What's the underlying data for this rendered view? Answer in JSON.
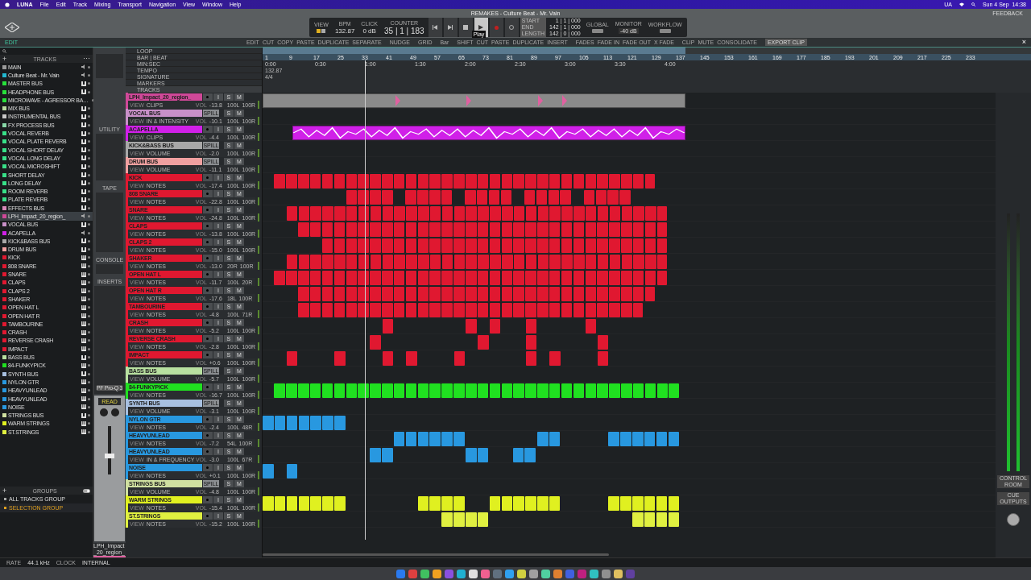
{
  "menu_bar": {
    "app": "LUNA",
    "items": [
      "File",
      "Edit",
      "Track",
      "Mixing",
      "Transport",
      "Navigation",
      "View",
      "Window",
      "Help"
    ],
    "status": "UA",
    "clock": "Sun 4 Sep  14:38"
  },
  "window": {
    "title": "REMAKES - Culture Beat - Mr. Vain",
    "feedback": "FEEDBACK"
  },
  "transport": {
    "sections": [
      {
        "label": "VIEW"
      },
      {
        "label": "BPM",
        "value": "132.87"
      },
      {
        "label": "CLICK",
        "value": "0 dB"
      },
      {
        "label": "COUNTER",
        "value": "35 | 1 | 183"
      }
    ],
    "tooltip": "Play",
    "times": [
      {
        "label": "START",
        "value": "1 | 1 | 000"
      },
      {
        "label": "END",
        "value": "142 | 1 | 000"
      },
      {
        "label": "LENGTH",
        "value": "142 | 0 | 000"
      }
    ],
    "right_sections": [
      {
        "label": "GLOBAL"
      },
      {
        "label": "MONITOR",
        "value": "-40 dB"
      },
      {
        "label": "WORKFLOW"
      }
    ]
  },
  "edit_toolbar": {
    "mode": "EDIT",
    "groups": [
      [
        "EDIT",
        "CUT",
        "COPY",
        "PASTE",
        "DUPLICATE",
        "SEPARATE"
      ],
      [
        "NUDGE"
      ],
      [
        "GRID"
      ],
      [
        "Bar"
      ],
      [
        "SHIFT",
        "CUT",
        "PASTE",
        "DUPLICATE",
        "INSERT"
      ],
      [
        "FADES",
        "FADE IN",
        "FADE OUT",
        "X FADE"
      ],
      [
        "CLIP",
        "MUTE",
        "CONSOLIDATE"
      ]
    ],
    "export": "EXPORT CLIP",
    "close": "×"
  },
  "sidebar": {
    "add": "+",
    "title": "TRACKS",
    "more": "⋯",
    "items": [
      {
        "name": "MAIN",
        "color": "#9a9a9a",
        "kind": "audio",
        "selected": false
      },
      {
        "name": "Culture Beat - Mr. Vain",
        "color": "#22b8d0",
        "kind": "audio",
        "selected": false
      },
      {
        "name": "MASTER BUS",
        "color": "#27e03a",
        "kind": "bus",
        "selected": false
      },
      {
        "name": "HEADPHONE BUS",
        "color": "#27e03a",
        "kind": "bus",
        "selected": false
      },
      {
        "name": "MICROWAVE - AGRESSOR BA…",
        "color": "#27e03a",
        "kind": "instrument",
        "selected": false
      },
      {
        "name": "MIX BUS",
        "color": "#b8d8a0",
        "kind": "bus",
        "selected": false
      },
      {
        "name": "INSTRUMENTAL BUS",
        "color": "#c8c8c8",
        "kind": "bus",
        "selected": false
      },
      {
        "name": "FX PROCESS BUS",
        "color": "#88d8a8",
        "kind": "bus",
        "selected": false
      },
      {
        "name": "VOCAL REVERB",
        "color": "#38e088",
        "kind": "bus",
        "selected": false
      },
      {
        "name": "VOCAL PLATE REVERB",
        "color": "#38e088",
        "kind": "bus",
        "selected": false
      },
      {
        "name": "VOCAL SHORT DELAY",
        "color": "#38e088",
        "kind": "bus",
        "selected": false
      },
      {
        "name": "VOCAL LONG DELAY",
        "color": "#38e088",
        "kind": "bus",
        "selected": false
      },
      {
        "name": "VOCAL MICROSHIFT",
        "color": "#38e088",
        "kind": "bus",
        "selected": false
      },
      {
        "name": "SHORT DELAY",
        "color": "#38e088",
        "kind": "bus",
        "selected": false
      },
      {
        "name": "LONG DELAY",
        "color": "#38e088",
        "kind": "bus",
        "selected": false
      },
      {
        "name": "ROOM REVERB",
        "color": "#38e088",
        "kind": "bus",
        "selected": false
      },
      {
        "name": "PLATE REVERB",
        "color": "#38e088",
        "kind": "bus",
        "selected": false
      },
      {
        "name": "EFFECTS BUS",
        "color": "#d888b8",
        "kind": "bus",
        "selected": false
      },
      {
        "name": "LPH_Impact_20_region_",
        "color": "#d04898",
        "kind": "audio",
        "selected": true
      },
      {
        "name": "VOCAL BUS",
        "color": "#c890c8",
        "kind": "bus",
        "selected": false
      },
      {
        "name": "ACAPELLA",
        "color": "#d020e8",
        "kind": "audio",
        "selected": false
      },
      {
        "name": "KICK&BASS BUS",
        "color": "#a8a8a8",
        "kind": "bus",
        "selected": false
      },
      {
        "name": "DRUM BUS",
        "color": "#f0a0a0",
        "kind": "bus",
        "selected": false
      },
      {
        "name": "KICK",
        "color": "#e01830",
        "kind": "instrument",
        "selected": false
      },
      {
        "name": "808 SNARE",
        "color": "#e01830",
        "kind": "instrument",
        "selected": false
      },
      {
        "name": "SNARE",
        "color": "#e01830",
        "kind": "instrument",
        "selected": false
      },
      {
        "name": "CLAPS",
        "color": "#e01830",
        "kind": "instrument",
        "selected": false
      },
      {
        "name": "CLAPS 2",
        "color": "#e01830",
        "kind": "instrument",
        "selected": false
      },
      {
        "name": "SHAKER",
        "color": "#e01830",
        "kind": "instrument",
        "selected": false
      },
      {
        "name": "OPEN HAT L",
        "color": "#e01830",
        "kind": "instrument",
        "selected": false
      },
      {
        "name": "OPEN HAT R",
        "color": "#e01830",
        "kind": "instrument",
        "selected": false
      },
      {
        "name": "TAMBOURINE",
        "color": "#e01830",
        "kind": "instrument",
        "selected": false
      },
      {
        "name": "CRASH",
        "color": "#e01830",
        "kind": "instrument",
        "selected": false
      },
      {
        "name": "REVERSE CRASH",
        "color": "#e01830",
        "kind": "instrument",
        "selected": false
      },
      {
        "name": "IMPACT",
        "color": "#e01830",
        "kind": "instrument",
        "selected": false
      },
      {
        "name": "BASS BUS",
        "color": "#b8e0a0",
        "kind": "bus",
        "selected": false
      },
      {
        "name": "84-FUNKYPICK",
        "color": "#20e020",
        "kind": "instrument",
        "selected": false
      },
      {
        "name": "SYNTH BUS",
        "color": "#a8c0e0",
        "kind": "bus",
        "selected": false
      },
      {
        "name": "NYLON GTR",
        "color": "#2898e0",
        "kind": "instrument",
        "selected": false
      },
      {
        "name": "HEAVYUNLEAD",
        "color": "#2898e0",
        "kind": "instrument",
        "selected": false
      },
      {
        "name": "HEAVYUNLEAD",
        "color": "#2898e0",
        "kind": "instrument",
        "selected": false
      },
      {
        "name": "NOISE",
        "color": "#2898e0",
        "kind": "instrument",
        "selected": false
      },
      {
        "name": "STRINGS BUS",
        "color": "#d0e0a0",
        "kind": "bus",
        "selected": false
      },
      {
        "name": "WARM STRINGS",
        "color": "#e0f020",
        "kind": "instrument",
        "selected": false
      },
      {
        "name": "ST.STRINGS",
        "color": "#e0f040",
        "kind": "instrument",
        "selected": false
      }
    ],
    "groups_add": "+",
    "groups_title": "GROUPS",
    "groups_on": true,
    "groups": [
      {
        "name": "ALL TRACKS GROUP",
        "selected": false
      },
      {
        "name": "SELECTION GROUP",
        "selected": true
      }
    ]
  },
  "channel_strip": {
    "labels": [
      "UTILITY",
      "TAPE",
      "CONSOLE",
      "INSERTS"
    ],
    "plugin": "PF Pro-Q 3",
    "automation": "READ",
    "track": "LPH_Impact_20_region_"
  },
  "ruler": {
    "rows": [
      "LOOP",
      "BAR | BEAT",
      "MIN:SEC",
      "TEMPO",
      "SIGNATURE",
      "MARKERS"
    ],
    "tracks_label": "TRACKS",
    "tempo": "132.87",
    "signature": "4/4",
    "bars": [
      "1",
      "9",
      "17",
      "25",
      "33",
      "41",
      "49",
      "57",
      "65",
      "73",
      "81",
      "89",
      "97",
      "105",
      "113",
      "121",
      "129",
      "137",
      "145",
      "153",
      "161",
      "169",
      "177",
      "185",
      "193",
      "201",
      "209",
      "217",
      "225",
      "233"
    ],
    "times": [
      "0:00",
      "0:30",
      "1:00",
      "1:30",
      "2:00",
      "2:30",
      "3:00",
      "3:30",
      "4:00"
    ]
  },
  "tracks": [
    {
      "name": "LPH_Impact_20_region_",
      "color": "#d04898",
      "kind": "track",
      "buttons": [
        "I",
        "S",
        "M"
      ],
      "view_label": "VIEW",
      "mode": "CLIPS",
      "vol_label": "VOL",
      "vol": "-13.8",
      "pan_l": "100L",
      "pan_r": "100R"
    },
    {
      "name": "VOCAL BUS",
      "color": "#c890c8",
      "kind": "bus",
      "buttons": [
        "SPILL",
        "S",
        "M"
      ],
      "view_label": "VIEW",
      "mode": "IN & INTENSITY",
      "vol_label": "VOL",
      "vol": "-10.1",
      "pan_l": "100L",
      "pan_r": "100R"
    },
    {
      "name": "ACAPELLA",
      "color": "#d020e8",
      "kind": "track",
      "buttons": [
        "I",
        "S",
        "M"
      ],
      "view_label": "VIEW",
      "mode": "CLIPS",
      "vol_label": "VOL",
      "vol": "-4.4",
      "pan_l": "100L",
      "pan_r": "100R"
    },
    {
      "name": "KICK&BASS BUS",
      "color": "#a8a8a8",
      "kind": "bus",
      "buttons": [
        "SPILL",
        "S",
        "M"
      ],
      "view_label": "VIEW",
      "mode": "VOLUME",
      "vol_label": "VOL",
      "vol": "-2.0",
      "pan_l": "100L",
      "pan_r": "100R"
    },
    {
      "name": "DRUM BUS",
      "color": "#f0a0a0",
      "kind": "bus",
      "buttons": [
        "SPILL",
        "S",
        "M"
      ],
      "view_label": "VIEW",
      "mode": "VOLUME",
      "vol_label": "VOL",
      "vol": "-11.1",
      "pan_l": "100L",
      "pan_r": "100R"
    },
    {
      "name": "KICK",
      "color": "#e01830",
      "kind": "track",
      "buttons": [
        "I",
        "S",
        "M"
      ],
      "view_label": "VIEW",
      "mode": "NOTES",
      "vol_label": "VOL",
      "vol": "-17.4",
      "pan_l": "100L",
      "pan_r": "100R"
    },
    {
      "name": "808 SNARE",
      "color": "#e01830",
      "kind": "track",
      "buttons": [
        "I",
        "S",
        "M"
      ],
      "view_label": "VIEW",
      "mode": "NOTES",
      "vol_label": "VOL",
      "vol": "-22.8",
      "pan_l": "100L",
      "pan_r": "100R"
    },
    {
      "name": "SNARE",
      "color": "#e01830",
      "kind": "track",
      "buttons": [
        "I",
        "S",
        "M"
      ],
      "view_label": "VIEW",
      "mode": "NOTES",
      "vol_label": "VOL",
      "vol": "-24.8",
      "pan_l": "100L",
      "pan_r": "100R"
    },
    {
      "name": "CLAPS",
      "color": "#e01830",
      "kind": "track",
      "buttons": [
        "I",
        "S",
        "M"
      ],
      "view_label": "VIEW",
      "mode": "NOTES",
      "vol_label": "VOL",
      "vol": "-13.8",
      "pan_l": "100L",
      "pan_r": "100R"
    },
    {
      "name": "CLAPS 2",
      "color": "#e01830",
      "kind": "track",
      "buttons": [
        "I",
        "S",
        "M"
      ],
      "view_label": "VIEW",
      "mode": "NOTES",
      "vol_label": "VOL",
      "vol": "-15.0",
      "pan_l": "100L",
      "pan_r": "100R"
    },
    {
      "name": "SHAKER",
      "color": "#e01830",
      "kind": "track",
      "buttons": [
        "I",
        "S",
        "M"
      ],
      "view_label": "VIEW",
      "mode": "NOTES",
      "vol_label": "VOL",
      "vol": "-13.0",
      "pan_l": "20R",
      "pan_r": "100R"
    },
    {
      "name": "OPEN HAT L",
      "color": "#e01830",
      "kind": "track",
      "buttons": [
        "I",
        "S",
        "M"
      ],
      "view_label": "VIEW",
      "mode": "NOTES",
      "vol_label": "VOL",
      "vol": "-11.7",
      "pan_l": "100L",
      "pan_r": "20R"
    },
    {
      "name": "OPEN HAT R",
      "color": "#e01830",
      "kind": "track",
      "buttons": [
        "I",
        "S",
        "M"
      ],
      "view_label": "VIEW",
      "mode": "NOTES",
      "vol_label": "VOL",
      "vol": "-17.6",
      "pan_l": "18L",
      "pan_r": "100R"
    },
    {
      "name": "TAMBOURINE",
      "color": "#e01830",
      "kind": "track",
      "buttons": [
        "I",
        "S",
        "M"
      ],
      "view_label": "VIEW",
      "mode": "NOTES",
      "vol_label": "VOL",
      "vol": "-4.8",
      "pan_l": "100L",
      "pan_r": "71R"
    },
    {
      "name": "CRASH",
      "color": "#e01830",
      "kind": "track",
      "buttons": [
        "I",
        "S",
        "M"
      ],
      "view_label": "VIEW",
      "mode": "NOTES",
      "vol_label": "VOL",
      "vol": "-5.2",
      "pan_l": "100L",
      "pan_r": "100R"
    },
    {
      "name": "REVERSE CRASH",
      "color": "#e01830",
      "kind": "track",
      "buttons": [
        "I",
        "S",
        "M"
      ],
      "view_label": "VIEW",
      "mode": "NOTES",
      "vol_label": "VOL",
      "vol": "-2.8",
      "pan_l": "100L",
      "pan_r": "100R"
    },
    {
      "name": "IMPACT",
      "color": "#e01830",
      "kind": "track",
      "buttons": [
        "I",
        "S",
        "M"
      ],
      "view_label": "VIEW",
      "mode": "NOTES",
      "vol_label": "VOL",
      "vol": "+0.6",
      "pan_l": "100L",
      "pan_r": "100R"
    },
    {
      "name": "BASS BUS",
      "color": "#b8e0a0",
      "kind": "bus",
      "buttons": [
        "SPILL",
        "S",
        "M"
      ],
      "view_label": "VIEW",
      "mode": "VOLUME",
      "vol_label": "VOL",
      "vol": "-5.7",
      "pan_l": "100L",
      "pan_r": "100R"
    },
    {
      "name": "84-FUNKYPICK",
      "color": "#20e020",
      "kind": "track",
      "buttons": [
        "I",
        "S",
        "M"
      ],
      "view_label": "VIEW",
      "mode": "NOTES",
      "vol_label": "VOL",
      "vol": "-16.7",
      "pan_l": "100L",
      "pan_r": "100R"
    },
    {
      "name": "SYNTH BUS",
      "color": "#a8c0e0",
      "kind": "bus",
      "buttons": [
        "SPILL",
        "S",
        "M"
      ],
      "view_label": "VIEW",
      "mode": "VOLUME",
      "vol_label": "VOL",
      "vol": "-3.1",
      "pan_l": "100L",
      "pan_r": "100R"
    },
    {
      "name": "NYLON GTR",
      "color": "#2898e0",
      "kind": "track",
      "buttons": [
        "I",
        "S",
        "M"
      ],
      "view_label": "VIEW",
      "mode": "NOTES",
      "vol_label": "VOL",
      "vol": "-2.4",
      "pan_l": "100L",
      "pan_r": "48R"
    },
    {
      "name": "HEAVYUNLEAD",
      "color": "#2898e0",
      "kind": "track",
      "buttons": [
        "I",
        "S",
        "M"
      ],
      "view_label": "VIEW",
      "mode": "NOTES",
      "vol_label": "VOL",
      "vol": "-7.2",
      "pan_l": "54L",
      "pan_r": "100R"
    },
    {
      "name": "HEAVYUNLEAD",
      "color": "#2898e0",
      "kind": "track",
      "buttons": [
        "I",
        "S",
        "M"
      ],
      "view_label": "VIEW",
      "mode": "IN & FREQUENCY",
      "vol_label": "VOL",
      "vol": "-3.0",
      "pan_l": "100L",
      "pan_r": "67R"
    },
    {
      "name": "NOISE",
      "color": "#2898e0",
      "kind": "track",
      "buttons": [
        "I",
        "S",
        "M"
      ],
      "view_label": "VIEW",
      "mode": "NOTES",
      "vol_label": "VOL",
      "vol": "+0.1",
      "pan_l": "100L",
      "pan_r": "100R"
    },
    {
      "name": "STRINGS BUS",
      "color": "#d0e0a0",
      "kind": "bus",
      "buttons": [
        "SPILL",
        "S",
        "M"
      ],
      "view_label": "VIEW",
      "mode": "VOLUME",
      "vol_label": "VOL",
      "vol": "-4.8",
      "pan_l": "100L",
      "pan_r": "100R"
    },
    {
      "name": "WARM STRINGS",
      "color": "#e0f020",
      "kind": "track",
      "buttons": [
        "I",
        "S",
        "M"
      ],
      "view_label": "VIEW",
      "mode": "NOTES",
      "vol_label": "VOL",
      "vol": "-15.4",
      "pan_l": "100L",
      "pan_r": "100R"
    },
    {
      "name": "ST.STRINGS",
      "color": "#e0f040",
      "kind": "track",
      "buttons": [
        "I",
        "S",
        "M"
      ],
      "view_label": "VIEW",
      "mode": "NOTES",
      "vol_label": "VOL",
      "vol": "-15.2",
      "pan_l": "100L",
      "pan_r": "100R"
    }
  ],
  "meter": {
    "buttons": [
      "CONTROL ROOM",
      "CUE OUTPUTS"
    ]
  },
  "status_bar": {
    "rate_label": "RATE",
    "rate": "44.1 kHz",
    "clock_label": "CLOCK",
    "clock": "INTERNAL"
  }
}
